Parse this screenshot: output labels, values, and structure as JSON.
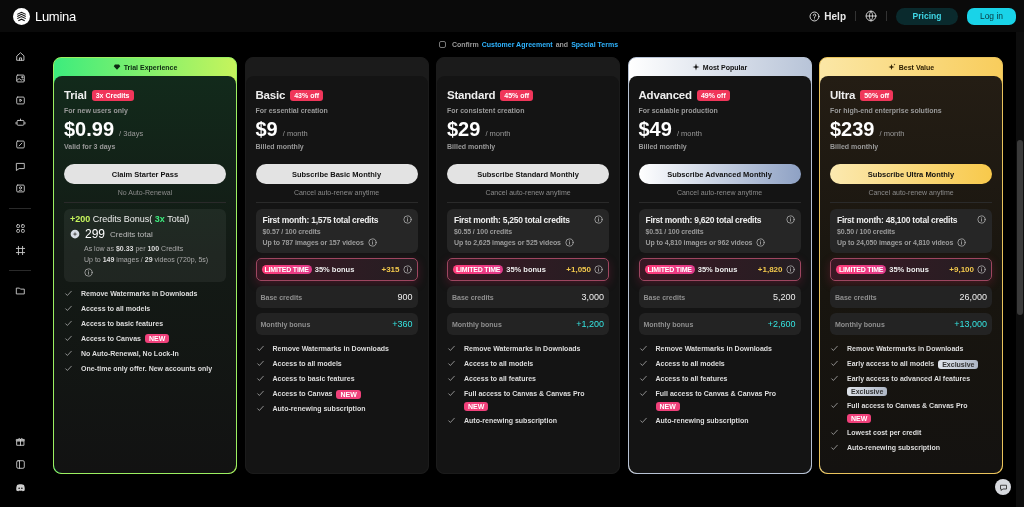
{
  "header": {
    "brand": "Lumina",
    "help": "Help",
    "pricing_button": "Pricing",
    "login_button": "Log in"
  },
  "confirm": {
    "checked": false,
    "label": "Confirm",
    "links": [
      "Customer Agreement",
      "Special Terms"
    ],
    "joiner": "and"
  },
  "plans": [
    {
      "kind": "trial",
      "ribbon": "Trial Experience",
      "name": "Trial",
      "badge": "3x Credits",
      "tagline": "For new users only",
      "price": "$0.99",
      "period": "/ 3days",
      "billing": "Valid for 3 days",
      "button": "Claim Starter Pass",
      "note": "No Auto-Renewal",
      "bonus": {
        "amount": "+200",
        "label": "Credits Bonus(",
        "multiplier": "3x",
        "suffix": "Total)"
      },
      "total": "299",
      "total_label": "Credits total",
      "rate": "As low as **$0.33** per **100** Credits",
      "usage": "Up to **149** images / **29** videos (720p, 5s)",
      "features": [
        {
          "text": "Remove Watermarks in Downloads"
        },
        {
          "text": "Access to all models"
        },
        {
          "text": "Access to basic features"
        },
        {
          "text": "Access to Canvas",
          "tag": {
            "kind": "new",
            "text": "NEW"
          }
        },
        {
          "text": "No Auto-Renewal, No Lock-In"
        },
        {
          "text": "One-time only offer. New accounts only"
        }
      ]
    },
    {
      "kind": "subscription",
      "name": "Basic",
      "badge": "43% off",
      "tagline": "For essential creation",
      "price": "$9",
      "period": "/ month",
      "billing": "Billed monthly",
      "button": "Subscribe Basic Monthly",
      "note": "Cancel auto-renew anytime",
      "first_month": "First month: 1,575 total credits",
      "rate": "$0.57 / 100 credits",
      "usage": "Up to 787 images or 157 videos",
      "limited": {
        "tag": "LIMITED TIME",
        "label": "35% bonus",
        "amount": "+315"
      },
      "base_label": "Base credits",
      "base": "900",
      "monthly_label": "Monthly bonus",
      "monthly": "+360",
      "features": [
        {
          "text": "Remove Watermarks in Downloads"
        },
        {
          "text": "Access to all models"
        },
        {
          "text": "Access to basic features"
        },
        {
          "text": "Access to Canvas",
          "tag": {
            "kind": "new",
            "text": "NEW"
          }
        },
        {
          "text": "Auto-renewing subscription"
        }
      ]
    },
    {
      "kind": "subscription",
      "name": "Standard",
      "badge": "45% off",
      "tagline": "For consistent creation",
      "price": "$29",
      "period": "/ month",
      "billing": "Billed monthly",
      "button": "Subscribe Standard Monthly",
      "note": "Cancel auto-renew anytime",
      "first_month": "First month: 5,250 total credits",
      "rate": "$0.55 / 100 credits",
      "usage": "Up to 2,625 images or 525 videos",
      "limited": {
        "tag": "LIMITED TIME",
        "label": "35% bonus",
        "amount": "+1,050"
      },
      "base_label": "Base credits",
      "base": "3,000",
      "monthly_label": "Monthly bonus",
      "monthly": "+1,200",
      "features": [
        {
          "text": "Remove Watermarks in Downloads"
        },
        {
          "text": "Access to all models"
        },
        {
          "text": "Access to all features"
        },
        {
          "text": "Full access to Canvas & Canvas Pro",
          "tag": {
            "kind": "new",
            "text": "NEW"
          }
        },
        {
          "text": "Auto-renewing subscription"
        }
      ]
    },
    {
      "kind": "popular",
      "ribbon": "Most Popular",
      "name": "Advanced",
      "badge": "49% off",
      "tagline": "For scalable production",
      "price": "$49",
      "period": "/ month",
      "billing": "Billed monthly",
      "button": "Subscribe Advanced Monthly",
      "note": "Cancel auto-renew anytime",
      "first_month": "First month: 9,620 total credits",
      "rate": "$0.51 / 100 credits",
      "usage": "Up to 4,810 images or 962 videos",
      "limited": {
        "tag": "LIMITED TIME",
        "label": "35% bonus",
        "amount": "+1,820"
      },
      "base_label": "Base credits",
      "base": "5,200",
      "monthly_label": "Monthly bonus",
      "monthly": "+2,600",
      "features": [
        {
          "text": "Remove Watermarks in Downloads"
        },
        {
          "text": "Access to all models"
        },
        {
          "text": "Access to all features"
        },
        {
          "text": "Full access to Canvas & Canvas Pro",
          "tag": {
            "kind": "new",
            "text": "NEW"
          }
        },
        {
          "text": "Auto-renewing subscription"
        }
      ]
    },
    {
      "kind": "premium",
      "ribbon": "Best Value",
      "name": "Ultra",
      "badge": "50% off",
      "tagline": "For high-end enterprise solutions",
      "price": "$239",
      "period": "/ month",
      "billing": "Billed monthly",
      "button": "Subscribe Ultra Monthly",
      "note": "Cancel auto-renew anytime",
      "first_month": "First month: 48,100 total credits",
      "rate": "$0.50 / 100 credits",
      "usage": "Up to 24,050 images or 4,810 videos",
      "limited": {
        "tag": "LIMITED TIME",
        "label": "35% bonus",
        "amount": "+9,100"
      },
      "base_label": "Base credits",
      "base": "26,000",
      "monthly_label": "Monthly bonus",
      "monthly": "+13,000",
      "features": [
        {
          "text": "Remove Watermarks in Downloads"
        },
        {
          "text": "Early access to all models",
          "tag": {
            "kind": "exclusive",
            "text": "Exclusive"
          }
        },
        {
          "text": "Early access to advanced AI features",
          "tag": {
            "kind": "exclusive",
            "text": "Exclusive"
          }
        },
        {
          "text": "Full access to Canvas & Canvas Pro",
          "tag": {
            "kind": "new",
            "text": "NEW"
          }
        },
        {
          "text": "Lowest cost per credit"
        },
        {
          "text": "Auto-renewing subscription"
        }
      ]
    }
  ]
}
